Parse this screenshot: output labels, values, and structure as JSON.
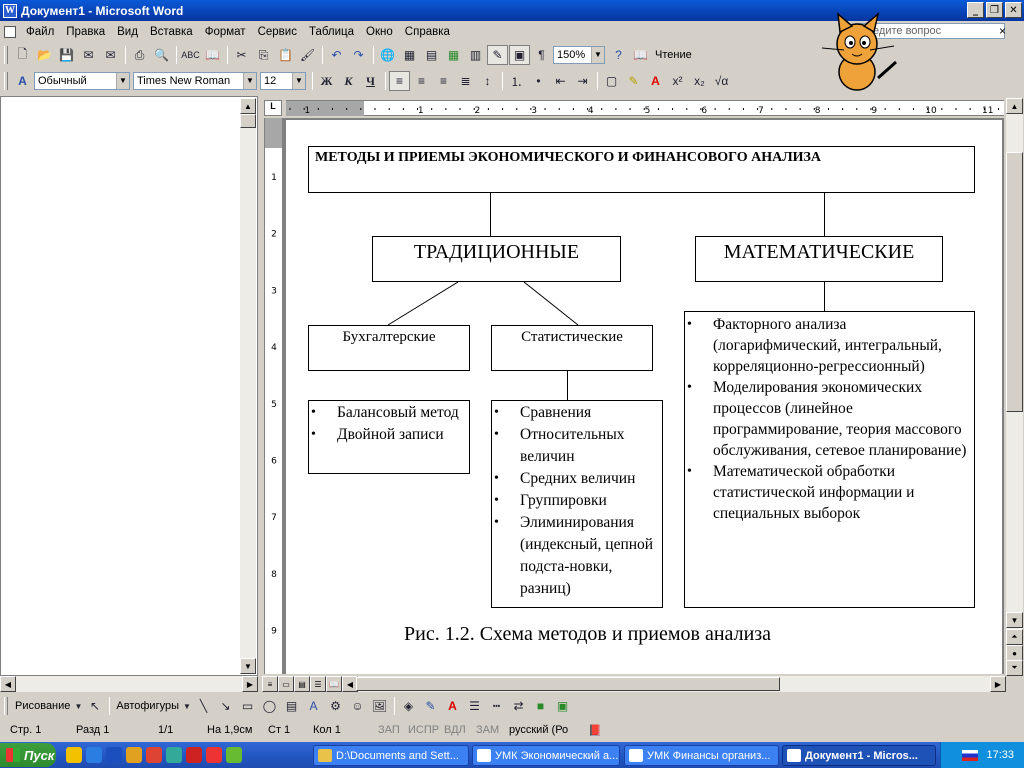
{
  "window": {
    "title": "Документ1 - Microsoft Word"
  },
  "menu": {
    "items": [
      "Файл",
      "Правка",
      "Вид",
      "Вставка",
      "Формат",
      "Сервис",
      "Таблица",
      "Окно",
      "Справка"
    ],
    "help_placeholder": "Введите вопрос",
    "close": "×"
  },
  "toolbar_standard": {
    "zoom": "150%",
    "reading_label": "Чтение"
  },
  "toolbar_format": {
    "style": "Обычный",
    "font": "Times New Roman",
    "size": "12",
    "bold": "Ж",
    "italic": "К",
    "underline": "Ч"
  },
  "ruler": {
    "corner": "L",
    "h_labels": [
      "1",
      "1",
      "2",
      "3",
      "4",
      "5",
      "6",
      "7",
      "8",
      "9",
      "10",
      "11"
    ],
    "v_labels": [
      "1",
      "2",
      "3",
      "4",
      "5",
      "6",
      "7",
      "8",
      "9"
    ]
  },
  "diagram": {
    "title": "МЕТОДЫ И ПРИЕМЫ ЭКОНОМИЧЕСКОГО И ФИНАНСОВОГО АНАЛИЗА",
    "traditional": "ТРАДИЦИОННЫЕ",
    "mathematical": "МАТЕМАТИЧЕСКИЕ",
    "accounting": "Бухгалтерские",
    "statistical": "Статистические",
    "accounting_items": [
      "Балансовый метод",
      "Двойной записи"
    ],
    "statistical_items": [
      "Сравнения",
      "Относительных величин",
      "Средних величин",
      "Группировки",
      "Элиминирования (индексный, цепной подста-новки, разниц)"
    ],
    "math_items": [
      "Факторного анализа (логарифмический, интегральный, корреляционно-регрессионный)",
      "Моделирования экономических процессов (линейное программирование, теория массового обслуживания, сетевое планирование)",
      "Математической обработки статистической информации и специальных выборок"
    ],
    "caption": "Рис. 1.2. Схема методов и приемов анализа"
  },
  "drawing_toolbar": {
    "drawing_label": "Рисование",
    "autoshapes_label": "Автофигуры"
  },
  "status": {
    "page": "Стр. 1",
    "section": "Разд 1",
    "pages": "1/1",
    "at": "На 1,9см",
    "line": "Ст 1",
    "col": "Кол 1",
    "rec": "ЗАП",
    "trk": "ИСПР",
    "ext": "ВДЛ",
    "ovr": "ЗАМ",
    "lang": "русский (Ро"
  },
  "taskbar": {
    "start": "Пуск",
    "tasks": [
      "D:\\Documents and Sett...",
      "УМК Экономический а...",
      "УМК Финансы организ...",
      "Документ1 - Micros..."
    ],
    "clock": "17:33"
  }
}
